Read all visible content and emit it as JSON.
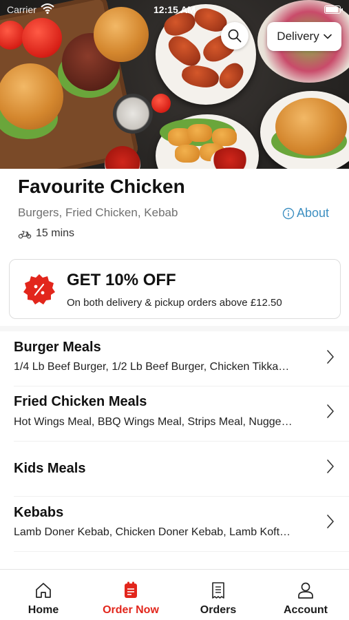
{
  "status_bar": {
    "carrier": "Carrier",
    "time": "12:15 AM"
  },
  "header": {
    "delivery_mode": "Delivery",
    "search_icon": "search-icon",
    "chevron_icon": "chevron-down-icon"
  },
  "restaurant": {
    "name": "Favourite Chicken",
    "cuisines": "Burgers, Fried Chicken, Kebab",
    "about_label": "About",
    "delivery_time": "15 mins"
  },
  "offer": {
    "headline": "GET 10% OFF",
    "description": "On both delivery & pickup orders above £12.50",
    "accent": "#e2261c"
  },
  "categories": [
    {
      "name": "Burger Meals",
      "items": "1/4 Lb Beef Burger, 1/2 Lb Beef Burger, Chicken Tikka…"
    },
    {
      "name": "Fried Chicken Meals",
      "items": "Hot Wings Meal, BBQ Wings Meal, Strips Meal, Nugge…"
    },
    {
      "name": "Kids Meals",
      "items": ""
    },
    {
      "name": "Kebabs",
      "items": "Lamb Doner Kebab, Chicken Doner Kebab, Lamb Koft…"
    }
  ],
  "tabs": [
    {
      "label": "Home",
      "icon": "home-icon",
      "active": false
    },
    {
      "label": "Order Now",
      "icon": "order-icon",
      "active": true
    },
    {
      "label": "Orders",
      "icon": "receipt-icon",
      "active": false
    },
    {
      "label": "Account",
      "icon": "user-icon",
      "active": false
    }
  ],
  "colors": {
    "accent_red": "#e2261c",
    "link_blue": "#3d8fc1"
  }
}
